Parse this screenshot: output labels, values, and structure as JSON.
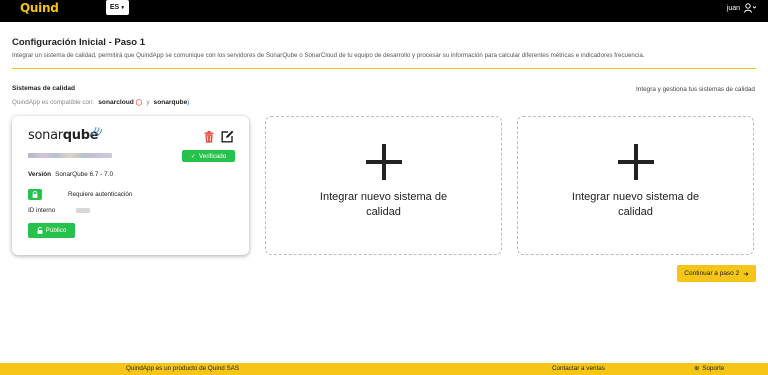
{
  "header": {
    "logo": "Quind",
    "language": "ES",
    "user": "juan"
  },
  "page": {
    "title": "Configuración Inicial - Paso 1",
    "intro": "Integrar un sistema de calidad, permitirá que QuindApp se comunique con los servidores de SonarQube o SonarCloud de tu equipo de desarrollo y procesar su información para calcular diferentes métricas e indicadores frecuencia."
  },
  "quality": {
    "section_title": "Sistemas de calidad",
    "manage_text": "Integra y gestiona tus sistemas de calidad",
    "compat_text": "QuindApp es compatible con:",
    "compat_brand1": "sonarcloud",
    "compat_and": "y",
    "compat_brand2": "sonarqube"
  },
  "system_card": {
    "logo_light": "sonar",
    "logo_bold": "qube",
    "status": "Verificado",
    "version_label": "Versión",
    "version_value": "SonarQube 6.7 - 7.0",
    "auth_label": "Requiere autenticación",
    "id_label": "ID interno",
    "visibility": "Público"
  },
  "add_cards": [
    {
      "label": "Integrar nuevo sistema de calidad"
    },
    {
      "label": "Integrar nuevo sistema de calidad"
    }
  ],
  "actions": {
    "next": "Continuar a paso 2"
  },
  "footer": {
    "product": "QuindApp es un producto de Quind SAS",
    "sales": "Contactar a ventas",
    "support": "Soporte"
  },
  "colors": {
    "brand_yellow": "#f5c518",
    "success_green": "#27c24c",
    "danger_red": "#e74c3c"
  }
}
